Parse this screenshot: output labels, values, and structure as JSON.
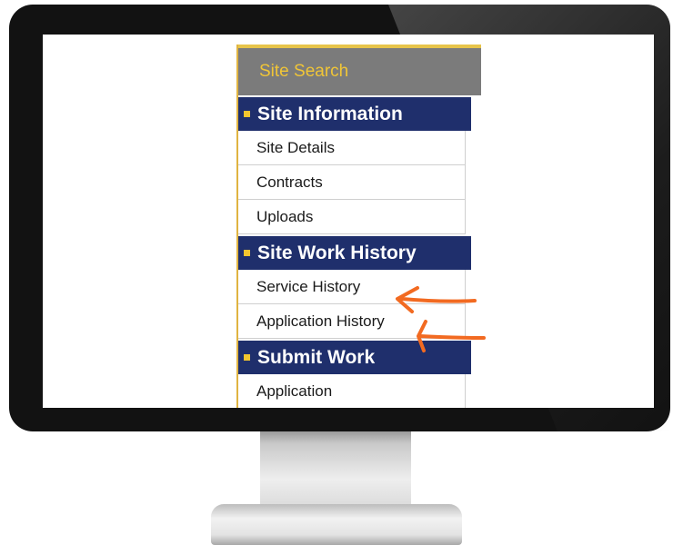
{
  "menu": {
    "site_search": "Site Search",
    "sections": [
      {
        "title": "Site Information",
        "items": [
          "Site Details",
          "Contracts",
          "Uploads"
        ]
      },
      {
        "title": "Site Work History",
        "items": [
          "Service History",
          "Application History"
        ]
      },
      {
        "title": "Submit Work",
        "items": [
          "Application"
        ]
      }
    ]
  },
  "colors": {
    "section_bg": "#1f2f6c",
    "accent": "#f2c52f",
    "site_search_bg": "#7b7b7b",
    "arrow": "#f26a21"
  },
  "annotations": [
    "arrow-icon",
    "arrow-icon"
  ]
}
